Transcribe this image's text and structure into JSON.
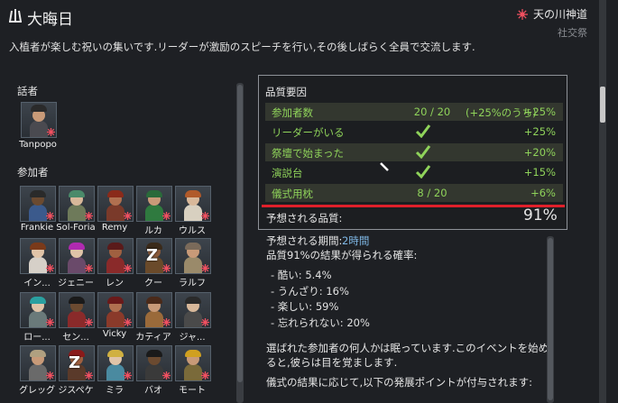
{
  "header": {
    "title": "大晦日",
    "ideoligion": "天の川神道",
    "category": "社交祭",
    "description": "入植者が楽しむ祝いの集いです.リーダーが激励のスピーチを行い,その後しばらく全員で交流します."
  },
  "speaker": {
    "label": "話者",
    "name": "Tanpopo"
  },
  "participants": {
    "label": "参加者",
    "items": [
      {
        "name": "Frankie",
        "skin": "#6b4a30",
        "hair": "#2a2a2a",
        "clothes": "#3b5a8c"
      },
      {
        "name": "Sol-Foria",
        "skin": "#d8b89a",
        "hair": "#4a8a6a",
        "clothes": "#6e7a5a"
      },
      {
        "name": "Remy",
        "skin": "#b07050",
        "hair": "#8a2a1a",
        "clothes": "#7a3a2a"
      },
      {
        "name": "ルカ",
        "skin": "#c89a78",
        "hair": "#2a6a3a",
        "clothes": "#2f7a3f"
      },
      {
        "name": "ウルス",
        "skin": "#d8b89a",
        "hair": "#b05a2a",
        "clothes": "#d8d0c0"
      },
      {
        "name": "イン...",
        "skin": "#e0c4a8",
        "hair": "#7a3a1a",
        "clothes": "#d6d0c8"
      },
      {
        "name": "ジェニー",
        "skin": "#e0c4a8",
        "hair": "#b02ab0",
        "clothes": "#6a4a6a"
      },
      {
        "name": "レン",
        "skin": "#a06040",
        "hair": "#5a1a1a",
        "clothes": "#8a2a2a"
      },
      {
        "name": "クー",
        "skin": "#8a5a3a",
        "hair": "#3a2a1a",
        "clothes": "#6a4a2a",
        "sleeping": true
      },
      {
        "name": "ラルフ",
        "skin": "#c89a78",
        "hair": "#7a6a5a",
        "clothes": "#9a8a6a"
      },
      {
        "name": "ロー...",
        "skin": "#e0c4a8",
        "hair": "#2aa0a0",
        "clothes": "#6a7a7a"
      },
      {
        "name": "セン...",
        "skin": "#6b4a30",
        "hair": "#1a1a1a",
        "clothes": "#8a2a2a"
      },
      {
        "name": "Vicky",
        "skin": "#b07050",
        "hair": "#6a1a1a",
        "clothes": "#8a3a2a"
      },
      {
        "name": "カティア",
        "skin": "#c89a78",
        "hair": "#4a2a1a",
        "clothes": "#9a6a3a"
      },
      {
        "name": "ジャ...",
        "skin": "#d8b89a",
        "hair": "#2a2a2a",
        "clothes": "#4a4a4a"
      },
      {
        "name": "グレッグ",
        "skin": "#c89a78",
        "hair": "#b0a080",
        "clothes": "#6a6a6a"
      },
      {
        "name": "ジスペケ",
        "skin": "#a06040",
        "hair": "#8a1a1a",
        "clothes": "#5a3a2a",
        "sleeping": true
      },
      {
        "name": "ミラ",
        "skin": "#e0c4a8",
        "hair": "#d0b040",
        "clothes": "#4a8aa0"
      },
      {
        "name": "バオ",
        "skin": "#6b4a30",
        "hair": "#1a1a1a",
        "clothes": "#3a3a3a"
      },
      {
        "name": "モート",
        "skin": "#c89a78",
        "hair": "#d0a020",
        "clothes": "#7a6a3a"
      }
    ]
  },
  "quality": {
    "title": "品質要因",
    "rows": [
      {
        "label": "参加者数",
        "mid": "20 / 20",
        "extra": "(+25%のうち)",
        "value": "+25%",
        "check": false
      },
      {
        "label": "リーダーがいる",
        "mid": "",
        "value": "+25%",
        "check": true
      },
      {
        "label": "祭壇で始まった",
        "mid": "",
        "value": "+20%",
        "check": true
      },
      {
        "label": "演説台",
        "mid": "",
        "value": "+15%",
        "check": true
      },
      {
        "label": "儀式用枕",
        "mid": "8 / 20",
        "value": "+6%",
        "check": false
      }
    ],
    "expected_label": "予想される品質:",
    "expected_value": "91%"
  },
  "details": {
    "period_label": "予想される期間:",
    "period_value": "2時間",
    "probability_text": "品質91%の結果が得られる確率:",
    "outcomes": [
      "- 酷い: 5.4%",
      "- うんざり: 16%",
      "- 楽しい: 59%",
      "- 忘れられない: 20%"
    ],
    "sleeping_note_1": "選ばれた参加者の何人かは眠っています.このイベントを始め",
    "sleeping_note_2": "ると,彼らは目を覚まします.",
    "dev_points_note": "儀式の結果に応じて,以下の発展ポイントが付与されます:"
  },
  "colors": {
    "background": "#1e2024",
    "positive": "#8fd35a",
    "accent_red": "#e0202a",
    "link_blue": "#7fb8e6"
  },
  "icons": {
    "header": "ritual-candles-icon",
    "ideoligion": "ideo-star-icon",
    "check": "check-icon"
  }
}
